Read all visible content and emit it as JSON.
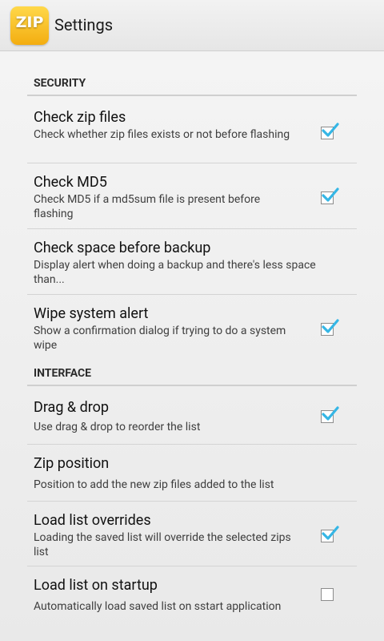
{
  "action_bar": {
    "title": "Settings",
    "icon_text": "ZIP",
    "icon_name": "zip-app-icon",
    "icon_color": "#f5b81a"
  },
  "sections": [
    {
      "header": "SECURITY",
      "items": [
        {
          "title": "Check zip files",
          "summary": "Check whether zip files exists or not before flashing",
          "checked": true
        },
        {
          "title": "Check MD5",
          "summary": "Check MD5 if a md5sum file is present before flashing",
          "checked": true
        },
        {
          "title": "Check space before backup",
          "summary": "Display alert when doing a backup and there's less space than...",
          "checked": null
        },
        {
          "title": "Wipe system alert",
          "summary": "Show a confirmation dialog if trying to do a system wipe",
          "checked": true
        }
      ]
    },
    {
      "header": "INTERFACE",
      "items": [
        {
          "title": "Drag & drop",
          "summary": "Use drag & drop to reorder the list",
          "checked": true
        },
        {
          "title": "Zip position",
          "summary": "Position to add the new zip files added to the list",
          "checked": null
        },
        {
          "title": "Load list overrides",
          "summary": "Loading the saved list will override the selected zips list",
          "checked": true
        },
        {
          "title": "Load list on startup",
          "summary": "Automatically load saved list on sstart application",
          "checked": false
        }
      ]
    }
  ],
  "colors": {
    "checkmark": "#35b6e5",
    "divider": "#cfcfcf"
  }
}
